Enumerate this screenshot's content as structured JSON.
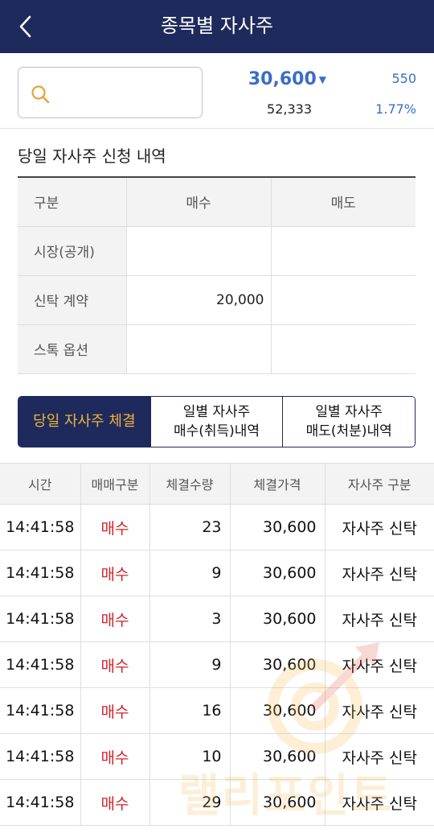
{
  "header": {
    "title": "종목별 자사주"
  },
  "quote": {
    "price": "30,600",
    "change": "550",
    "volume": "52,333",
    "rate": "1.77%"
  },
  "section": {
    "title": "당일 자사주 신청 내역"
  },
  "summary": {
    "headers": [
      "구분",
      "매수",
      "매도"
    ],
    "rows": [
      {
        "label": "시장(공개)",
        "buy": "",
        "sell": ""
      },
      {
        "label": "신탁 계약",
        "buy": "20,000",
        "sell": ""
      },
      {
        "label": "스톡 옵션",
        "buy": "",
        "sell": ""
      }
    ]
  },
  "tabs": [
    {
      "line1": "당일 자사주 체결",
      "line2": ""
    },
    {
      "line1": "일별 자사주",
      "line2": "매수(취득)내역"
    },
    {
      "line1": "일별 자사주",
      "line2": "매도(처분)내역"
    }
  ],
  "trades": {
    "headers": [
      "시간",
      "매매구분",
      "체결수량",
      "체결가격",
      "자사주 구분"
    ],
    "rows": [
      [
        "14:41:58",
        "매수",
        "23",
        "30,600",
        "자사주 신탁"
      ],
      [
        "14:41:58",
        "매수",
        "9",
        "30,600",
        "자사주 신탁"
      ],
      [
        "14:41:58",
        "매수",
        "3",
        "30,600",
        "자사주 신탁"
      ],
      [
        "14:41:58",
        "매수",
        "9",
        "30,600",
        "자사주 신탁"
      ],
      [
        "14:41:58",
        "매수",
        "16",
        "30,600",
        "자사주 신탁"
      ],
      [
        "14:41:58",
        "매수",
        "10",
        "30,600",
        "자사주 신탁"
      ],
      [
        "14:41:58",
        "매수",
        "29",
        "30,600",
        "자사주 신탁"
      ]
    ]
  },
  "watermark": {
    "text": "랠리포인트"
  },
  "colors": {
    "header": "#1e2a5c",
    "accent": "#f0b33a",
    "down": "#3a6ec6",
    "buy": "#d2232a"
  },
  "icons": {
    "back": "chevron-left-icon",
    "search": "search-icon",
    "down": "triangle-down-icon"
  }
}
